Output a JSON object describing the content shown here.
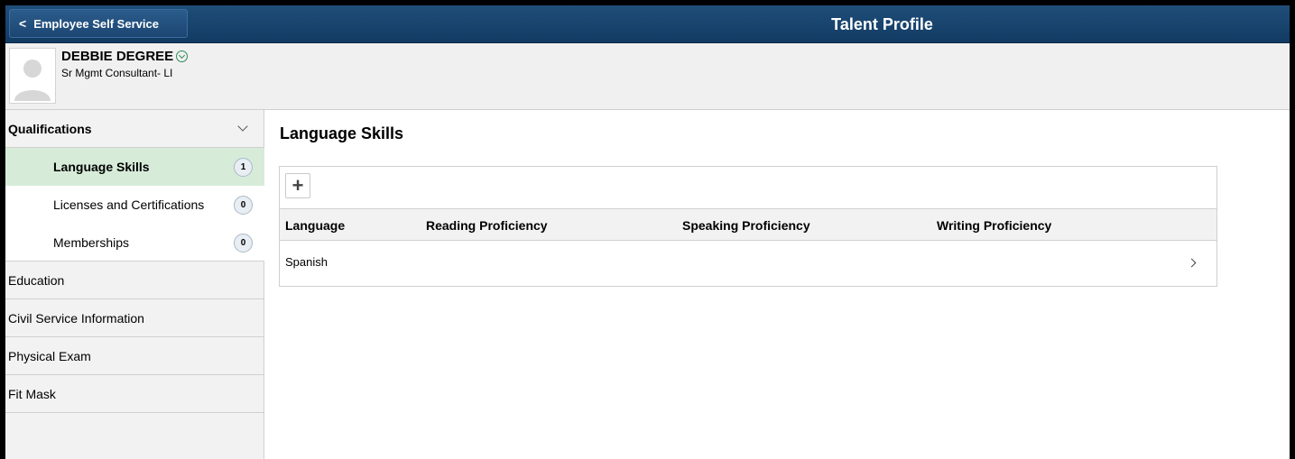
{
  "header": {
    "back_label": "Employee Self Service",
    "page_title": "Talent Profile"
  },
  "employee": {
    "name": "DEBBIE DEGREE",
    "title": "Sr Mgmt Consultant- LI"
  },
  "sidebar": {
    "groups": [
      {
        "label": "Qualifications",
        "expanded": true,
        "items": [
          {
            "label": "Language Skills",
            "count": "1",
            "active": true
          },
          {
            "label": "Licenses and Certifications",
            "count": "0",
            "active": false
          },
          {
            "label": "Memberships",
            "count": "0",
            "active": false
          }
        ]
      },
      {
        "label": "Education"
      },
      {
        "label": "Civil Service Information"
      },
      {
        "label": "Physical Exam"
      },
      {
        "label": "Fit Mask"
      }
    ]
  },
  "main": {
    "section_title": "Language Skills",
    "columns": [
      "Language",
      "Reading Proficiency",
      "Speaking Proficiency",
      "Writing Proficiency"
    ],
    "rows": [
      {
        "language": "Spanish",
        "reading": "",
        "speaking": "",
        "writing": ""
      }
    ]
  },
  "colors": {
    "header_bg": "#1f4e79",
    "active_item_bg": "#d6ecd9",
    "sidebar_bg": "#f2f2f2",
    "status_icon": "#2e8b57"
  },
  "icons": {
    "back": "chevron-left-icon",
    "add": "plus-icon",
    "row_detail": "chevron-right-icon",
    "group_toggle": "chevron-down-icon",
    "name_menu": "circle-chevron-down-icon",
    "avatar": "person-silhouette-icon"
  }
}
